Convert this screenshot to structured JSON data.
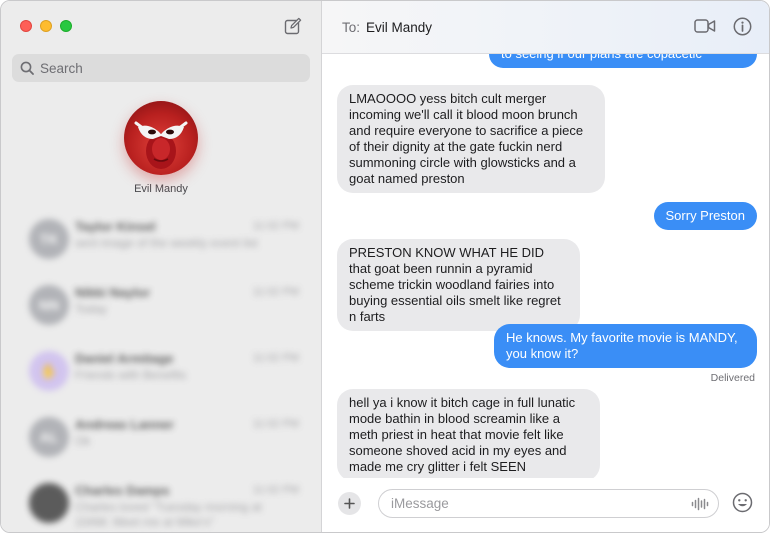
{
  "sidebar": {
    "search_placeholder": "Search",
    "pinned": {
      "name": "Evil Mandy"
    },
    "conversations": [
      {
        "initials": "TK",
        "name": "Taylor Kinsel",
        "time": "11:02 PM",
        "preview": "sent image of the weekly event list"
      },
      {
        "initials": "NN",
        "name": "Nikki Naylor",
        "time": "11:02 PM",
        "preview": "Today"
      },
      {
        "initials": "✋",
        "name": "Daniel Armitage",
        "time": "11:02 PM",
        "preview": "Friends with Benefits"
      },
      {
        "initials": "AL",
        "name": "Andreas Lanner",
        "time": "11:02 PM",
        "preview": "Ok"
      },
      {
        "initials": "",
        "name": "Charles Damps",
        "time": "11:02 PM",
        "preview": "Charles loved \"Tuesday morning at 10AM. Meet me at Mike's\""
      }
    ]
  },
  "header": {
    "to_label": "To:",
    "recipient": "Evil Mandy"
  },
  "messages": [
    {
      "dir": "out",
      "text": "to seeing if our plans are copacetic"
    },
    {
      "dir": "in",
      "text": "LMAOOOO yess bitch cult merger incoming we'll call it blood moon brunch and require everyone to sacrifice a piece of their dignity at the gate fuckin nerd summoning circle with glowsticks and a goat named preston"
    },
    {
      "dir": "out",
      "text": "Sorry Preston"
    },
    {
      "dir": "in",
      "text": "PRESTON KNOW WHAT HE DID that goat been runnin a pyramid scheme trickin woodland fairies into buying essential oils smelt like regret n farts"
    },
    {
      "dir": "out",
      "text": "He knows. My favorite movie is MANDY, you know it?"
    },
    {
      "dir": "in",
      "text": "hell ya i know it bitch cage in full lunatic mode bathin in blood screamin like a meth priest in heat that movie felt like someone shoved acid in my eyes and made me cry glitter i felt SEEN"
    }
  ],
  "status": {
    "delivered": "Delivered"
  },
  "composer": {
    "placeholder": "iMessage"
  },
  "colors": {
    "outgoing_bubble": "#3a8ef6",
    "incoming_bubble": "#e9e9eb"
  }
}
